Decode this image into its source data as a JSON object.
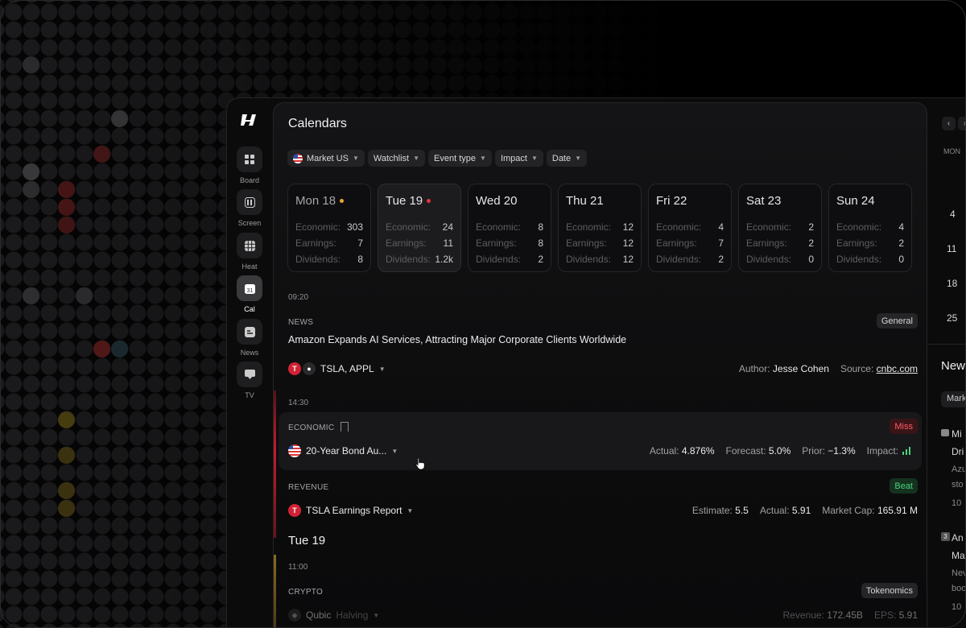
{
  "rail": {
    "items": [
      {
        "label": "Board",
        "icon": "grid-icon"
      },
      {
        "label": "Screen",
        "icon": "chart-icon"
      },
      {
        "label": "Heat",
        "icon": "heatmap-icon"
      },
      {
        "label": "Cal",
        "icon": "calendar-icon",
        "badge": "31"
      },
      {
        "label": "News",
        "icon": "news-icon"
      },
      {
        "label": "TV",
        "icon": "tv-icon"
      }
    ]
  },
  "main": {
    "title": "Calendars",
    "filters": [
      "Market US",
      "Watchlist",
      "Event type",
      "Impact",
      "Date"
    ],
    "days": [
      {
        "name": "Mon 18",
        "economic": "303",
        "earnings": "7",
        "dividends": "8"
      },
      {
        "name": "Tue 19",
        "economic": "24",
        "earnings": "11",
        "dividends": "1.2k"
      },
      {
        "name": "Wed 20",
        "economic": "8",
        "earnings": "8",
        "dividends": "2"
      },
      {
        "name": "Thu 21",
        "economic": "12",
        "earnings": "12",
        "dividends": "12"
      },
      {
        "name": "Fri 22",
        "economic": "4",
        "earnings": "7",
        "dividends": "2"
      },
      {
        "name": "Sat 23",
        "economic": "2",
        "earnings": "2",
        "dividends": "0"
      },
      {
        "name": "Sun 24",
        "economic": "4",
        "earnings": "2",
        "dividends": "0"
      }
    ],
    "stat_labels": {
      "economic": "Economic:",
      "earnings": "Earnings:",
      "dividends": "Dividends:"
    },
    "event1": {
      "time": "09:20",
      "category": "NEWS",
      "tag": "General",
      "headline": "Amazon Expands AI Services, Attracting Major Corporate Clients Worldwide",
      "tickers": "TSLA, APPL",
      "author_label": "Author:",
      "author": "Jesse Cohen",
      "source_label": "Source:",
      "source": "cnbc.com"
    },
    "event2": {
      "time": "14:30",
      "category": "ECONOMIC",
      "tag": "Miss",
      "title": "20-Year Bond Au...",
      "actual_label": "Actual:",
      "actual": "4.876%",
      "forecast_label": "Forecast:",
      "forecast": "5.0%",
      "prior_label": "Prior:",
      "prior": "−1.3%",
      "impact_label": "Impact:"
    },
    "event3": {
      "category": "REVENUE",
      "tag": "Beat",
      "title": "TSLA Earnings Report",
      "estimate_label": "Estimate:",
      "estimate": "5.5",
      "actual_label": "Actual:",
      "actual": "5.91",
      "mcap_label": "Market Cap:",
      "mcap": "165.91 M"
    },
    "section2": "Tue 19",
    "event4": {
      "time": "11:00",
      "category": "CRYPTO",
      "tag": "Tokenomics",
      "title": "Qubic",
      "subtitle": "Halving",
      "revenue_label": "Revenue:",
      "revenue": "172.45B",
      "eps_label": "EPS:",
      "eps": "5.91"
    }
  },
  "rpanel": {
    "weekday": "MON",
    "dates": [
      "4",
      "11",
      "18",
      "25"
    ],
    "news_title": "New",
    "chip": "Mark",
    "item1": [
      "Mi",
      "Dri",
      "Azu",
      "sto",
      "10"
    ],
    "item2_num": "3",
    "item2": [
      "An",
      "Ma",
      "Nev",
      "boo",
      "10"
    ]
  },
  "colors": {
    "miss": "#ff5a64",
    "beat": "#4ad27c",
    "today_dot": "#e5343d",
    "yesterday_dot": "#e8a33a"
  }
}
